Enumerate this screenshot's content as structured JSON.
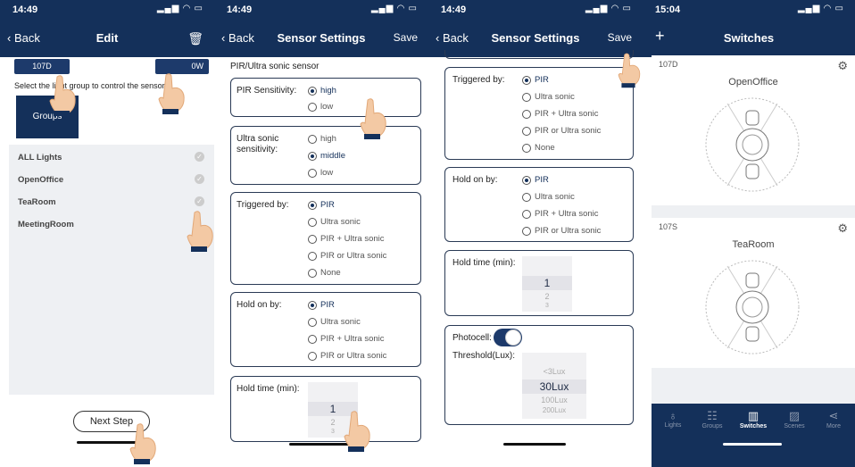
{
  "panel1": {
    "status_time": "14:49",
    "nav": {
      "back": "Back",
      "title": "Edit"
    },
    "left_button": "107D",
    "right_button": "0W",
    "instruction": "Select the light group to control the sensor",
    "groups_tile": "Groups",
    "list": [
      {
        "label": "ALL Lights"
      },
      {
        "label": "OpenOffice"
      },
      {
        "label": "TeaRoom"
      },
      {
        "label": "MeetingRoom"
      }
    ],
    "next_button": "Next Step"
  },
  "panel2": {
    "status_time": "14:49",
    "nav": {
      "back": "Back",
      "title": "Sensor Settings",
      "save": "Save"
    },
    "header": "PIR/Ultra sonic sensor",
    "pir_sensitivity": {
      "label": "PIR Sensitivity:",
      "options": [
        "high",
        "low"
      ]
    },
    "us_sensitivity": {
      "label": "Ultra sonic sensitivity:",
      "options": [
        "high",
        "middle",
        "low"
      ]
    },
    "triggered_by": {
      "label": "Triggered by:",
      "options": [
        "PIR",
        "Ultra sonic",
        "PIR + Ultra sonic",
        "PIR or Ultra sonic",
        "None"
      ]
    },
    "hold_on_by": {
      "label": "Hold on by:",
      "options": [
        "PIR",
        "Ultra sonic",
        "PIR + Ultra sonic",
        "PIR or Ultra sonic"
      ]
    },
    "hold_time": {
      "label": "Hold time (min):",
      "values": [
        "1",
        "2",
        "3"
      ]
    }
  },
  "panel3": {
    "status_time": "14:49",
    "nav": {
      "back": "Back",
      "title": "Sensor Settings",
      "save": "Save"
    },
    "triggered_by": {
      "label": "Triggered by:",
      "options": [
        "PIR",
        "Ultra sonic",
        "PIR + Ultra sonic",
        "PIR or Ultra sonic",
        "None"
      ]
    },
    "hold_on_by": {
      "label": "Hold on by:",
      "options": [
        "PIR",
        "Ultra sonic",
        "PIR + Ultra sonic",
        "PIR or Ultra sonic"
      ]
    },
    "hold_time": {
      "label": "Hold time (min):",
      "values": [
        "1",
        "2",
        "3"
      ]
    },
    "photocell": {
      "label": "Photocell:"
    },
    "threshold": {
      "label": "Threshold(Lux):",
      "values": [
        "<3Lux",
        "30Lux",
        "100Lux",
        "200Lux"
      ]
    }
  },
  "panel4": {
    "status_time": "15:04",
    "nav": {
      "title": "Switches"
    },
    "cards": [
      {
        "id": "107D",
        "name": "OpenOffice"
      },
      {
        "id": "107S",
        "name": "TeaRoom"
      }
    ],
    "tabs": [
      "Lights",
      "Groups",
      "Switches",
      "Scenes",
      "More"
    ]
  },
  "colors": {
    "navy": "#14305a",
    "accent": "#1d3a6b",
    "list_bg": "#eef0f3"
  }
}
